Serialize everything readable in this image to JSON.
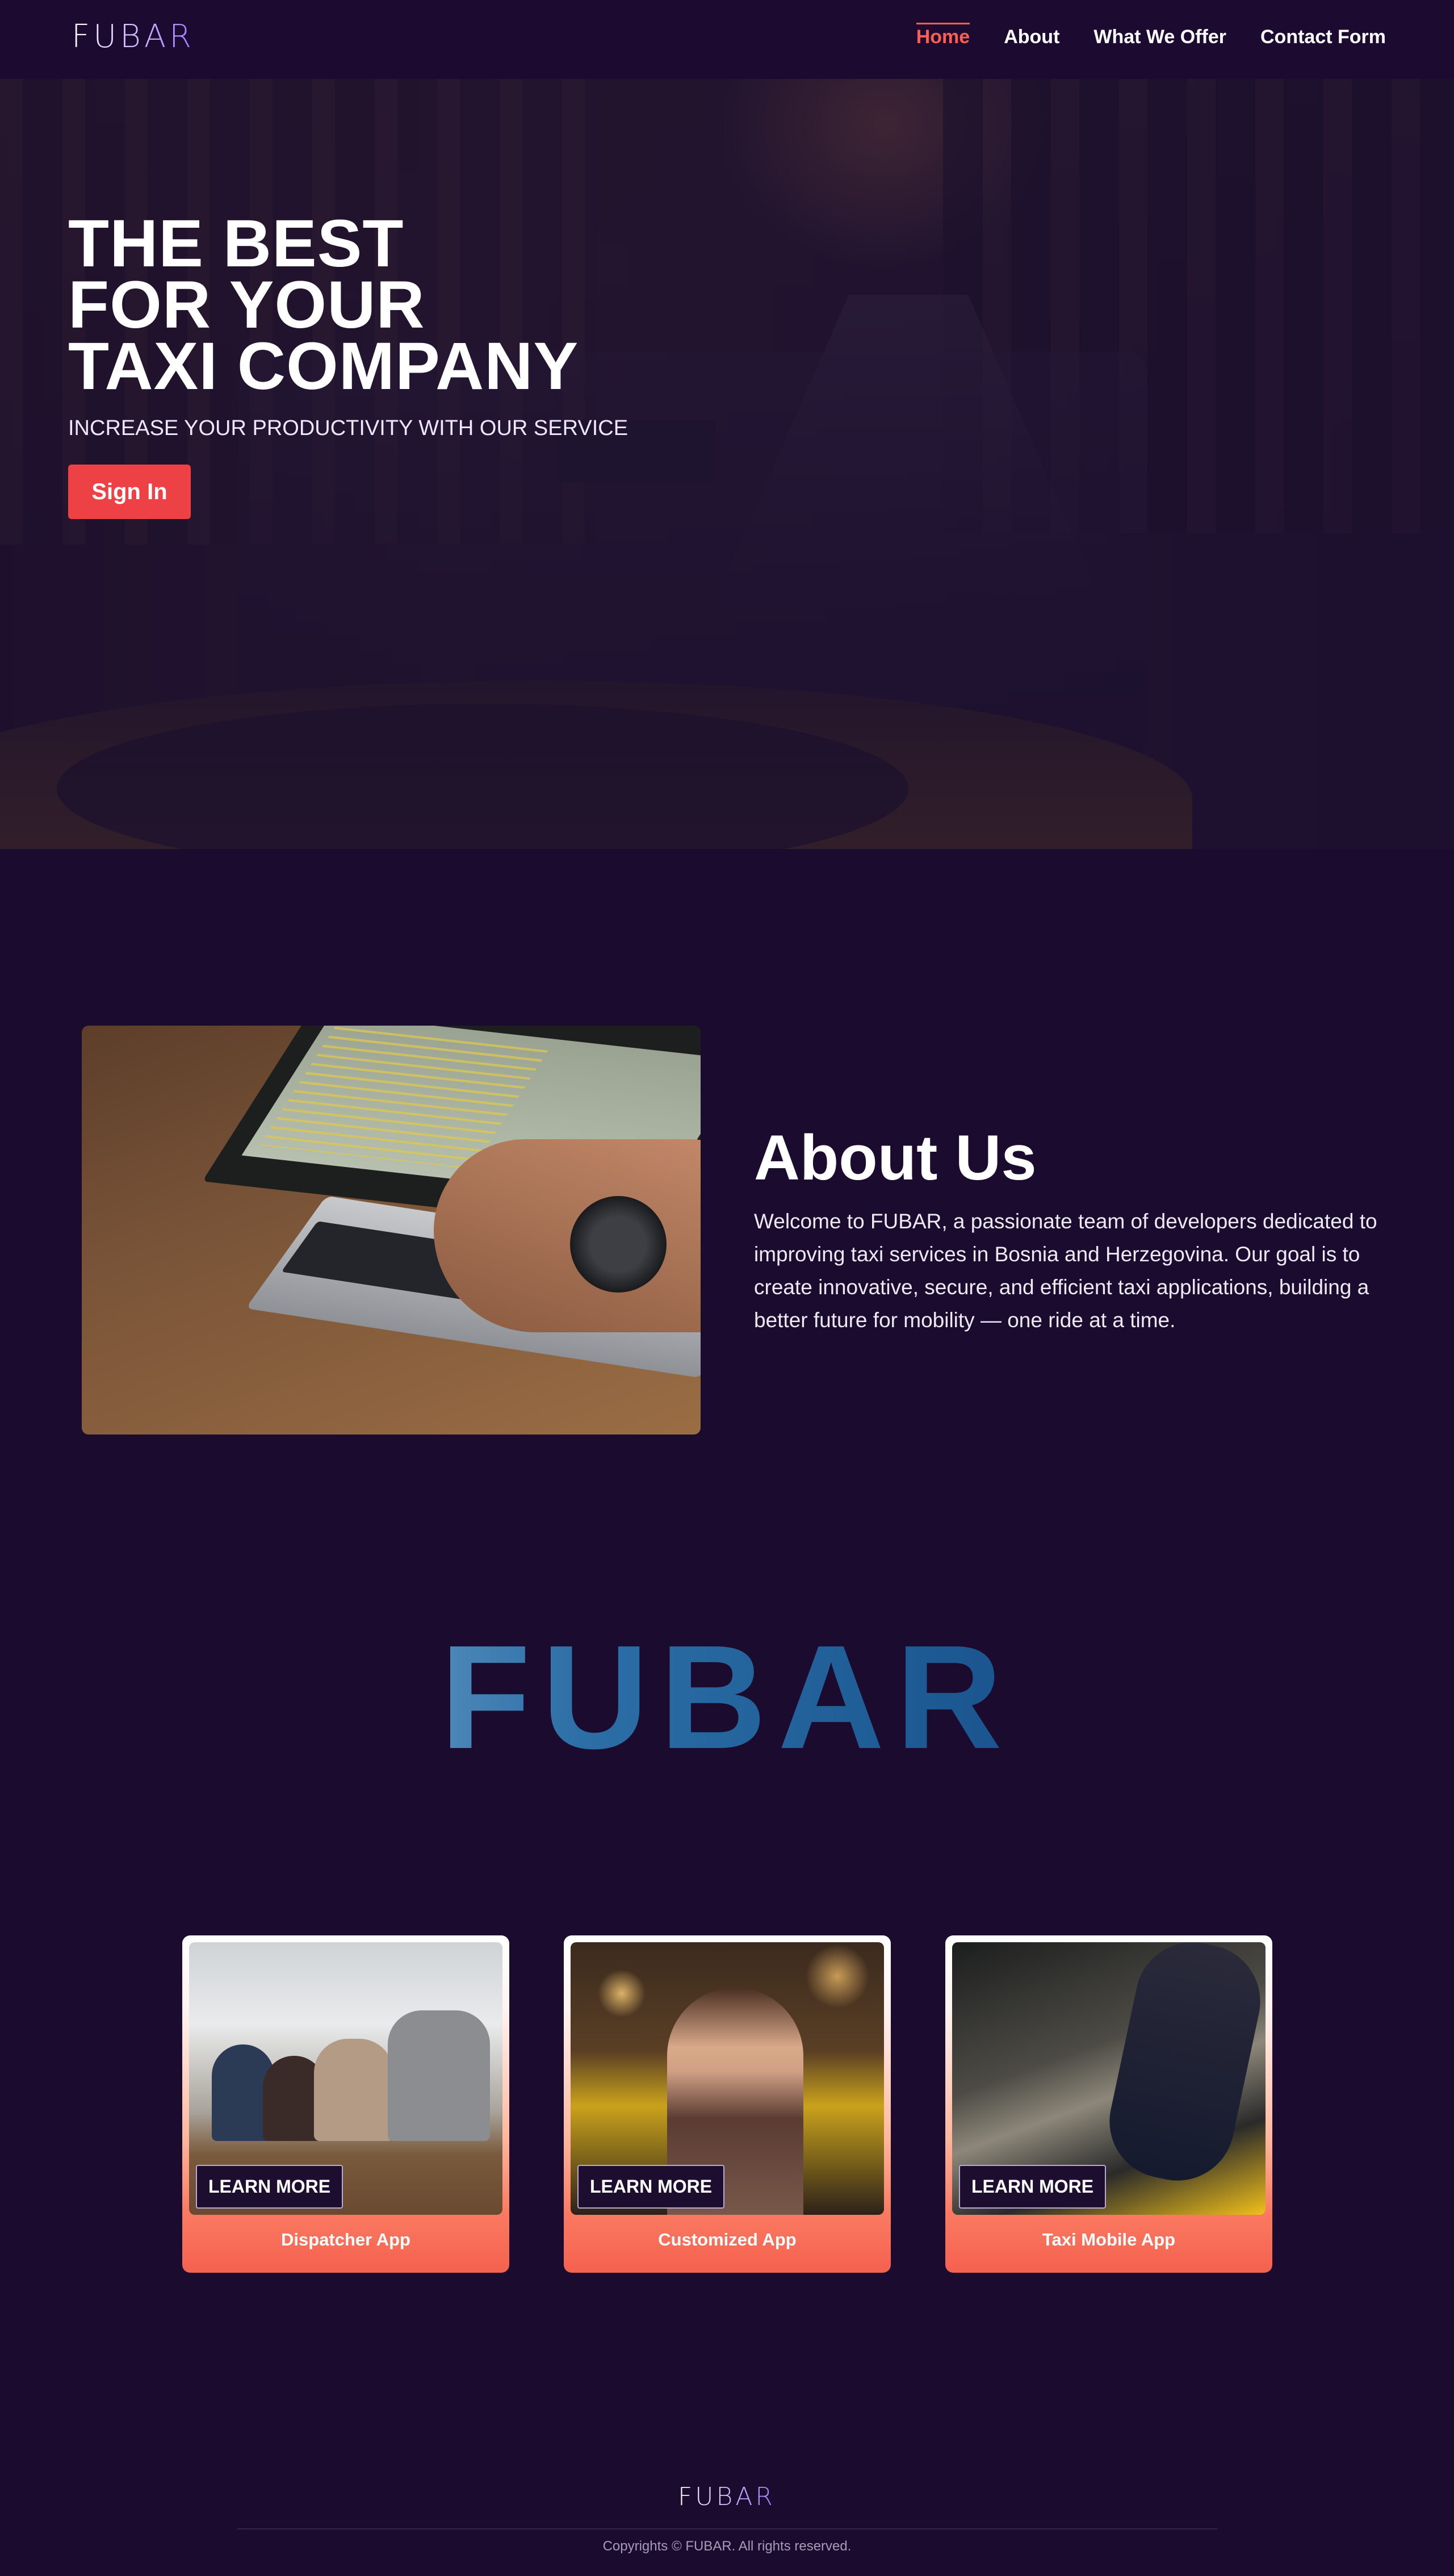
{
  "brand": {
    "logo_text": "FUBAR"
  },
  "nav": {
    "items": [
      {
        "label": "Home",
        "active": true
      },
      {
        "label": "About",
        "active": false
      },
      {
        "label": "What We Offer",
        "active": false
      },
      {
        "label": "Contact Form",
        "active": false
      }
    ]
  },
  "hero": {
    "title": "THE BEST\nFOR YOUR\nTAXI COMPANY",
    "subtitle": "INCREASE YOUR PRODUCTIVITY WITH OUR SERVICE",
    "cta_label": "Sign In"
  },
  "about": {
    "title": "About Us",
    "text": "Welcome to FUBAR, a passionate team of developers dedicated to improving taxi services in Bosnia and Herzegovina. Our goal is to create innovative, secure, and efficient taxi applications, building a better future for mobility — one ride at a time."
  },
  "banner": {
    "text": "FUBAR"
  },
  "cards": [
    {
      "label": "Dispatcher App",
      "button": "LEARN MORE"
    },
    {
      "label": "Customized App",
      "button": "LEARN MORE"
    },
    {
      "label": "Taxi Mobile App",
      "button": "LEARN MORE"
    }
  ],
  "footer": {
    "logo_text": "FUBAR",
    "copyright": "Copyrights © FUBAR. All rights reserved."
  },
  "colors": {
    "background": "#1b0b2e",
    "accent": "#ee4146",
    "nav_active": "#ff5f52"
  }
}
